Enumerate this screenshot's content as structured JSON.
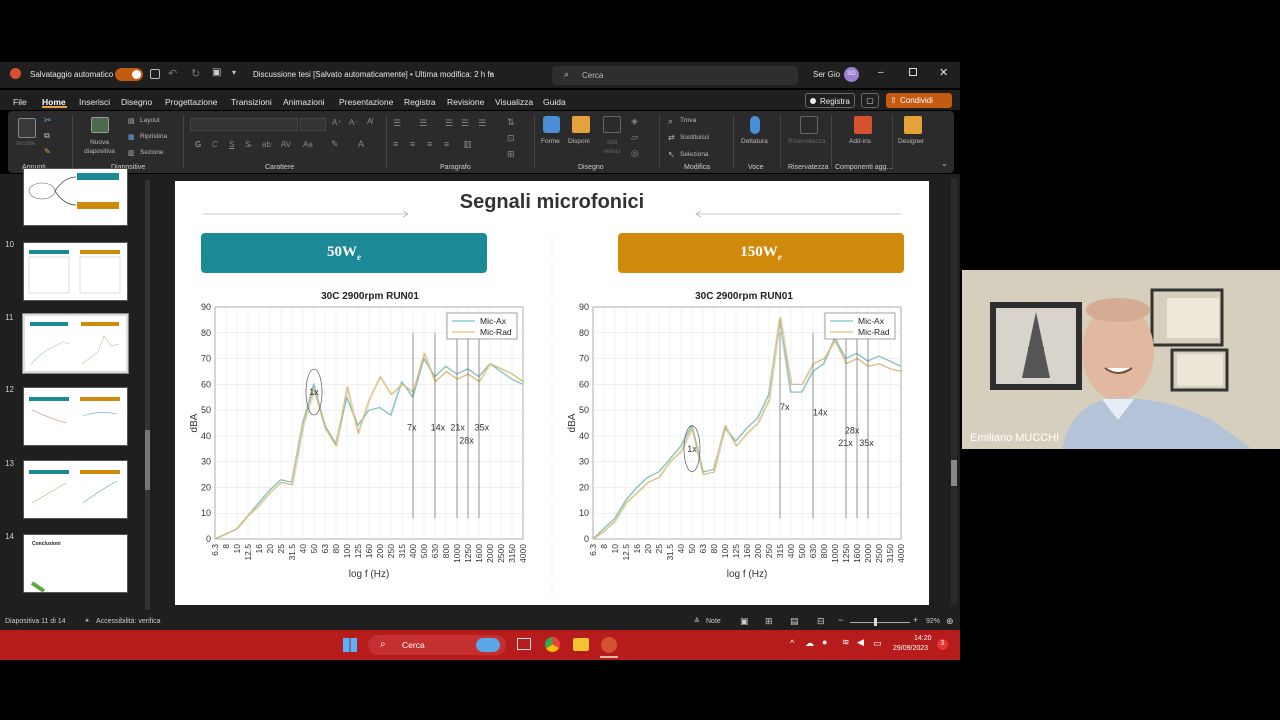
{
  "titlebar": {
    "autosave_label": "Salvataggio automatico",
    "doc_title": "Discussione tesi [Salvato automaticamente] • Ultima modifica: 2 h fa",
    "search_placeholder": "Cerca",
    "user_name": "Ser Gio",
    "user_initials": "SG"
  },
  "menu": {
    "items": [
      "File",
      "Home",
      "Inserisci",
      "Disegno",
      "Progettazione",
      "Transizioni",
      "Animazioni",
      "Presentazione",
      "Registra",
      "Revisione",
      "Visualizza",
      "Guida"
    ],
    "active": "Home",
    "record_button": "Registra",
    "share_button": "Condividi"
  },
  "ribbon": {
    "paste": "Incolla",
    "new_slide": "Nuova diapositiva",
    "layout": "Layout",
    "reset": "Ripristina",
    "section": "Sezione",
    "shapes": "Forme",
    "arrange": "Disponi",
    "quick_styles": "Stili veloci",
    "find": "Trova",
    "replace": "Sostituisci",
    "select": "Seleziona",
    "dictate": "Dettatura",
    "sensitivity": "Riservatezza",
    "addins": "Add-ins",
    "designer": "Designer",
    "groups": {
      "clipboard": "Appunti",
      "slides": "Diapositive",
      "font": "Carattere",
      "paragraph": "Paragrafo",
      "drawing": "Disegno",
      "editing": "Modifica",
      "voice": "Voce",
      "sensitivity": "Riservatezza",
      "addins": "Componenti agg..."
    }
  },
  "thumbnails": [
    {
      "num": "10"
    },
    {
      "num": "11"
    },
    {
      "num": "12"
    },
    {
      "num": "13"
    },
    {
      "num": "14",
      "title": "Conclusioni"
    }
  ],
  "slide": {
    "title": "Segnali microfonici",
    "left_header": "50W",
    "left_header_sub": "e",
    "right_header": "150W",
    "right_header_sub": "e",
    "colors": {
      "teal": "#1c8a96",
      "orange": "#d08a0b"
    }
  },
  "chart_data": [
    {
      "type": "line",
      "title": "30C 2900rpm RUN01",
      "xlabel": "log f (Hz)",
      "ylabel": "dBA",
      "ylim": [
        0,
        90
      ],
      "yticks": [
        0,
        10,
        20,
        30,
        40,
        50,
        60,
        70,
        80,
        90
      ],
      "categories": [
        "6.3",
        "8",
        "10",
        "12.5",
        "16",
        "20",
        "25",
        "31.5",
        "40",
        "50",
        "63",
        "80",
        "100",
        "125",
        "160",
        "200",
        "250",
        "315",
        "400",
        "500",
        "630",
        "800",
        "1000",
        "1250",
        "1600",
        "2000",
        "2500",
        "3150",
        "4000"
      ],
      "series": [
        {
          "name": "Mic-Ax",
          "color": "#74c6c9",
          "values": [
            0,
            2,
            4,
            9,
            14,
            19,
            23,
            22,
            45,
            60,
            44,
            37,
            55,
            44,
            50,
            51,
            48,
            61,
            55,
            70,
            63,
            67,
            64,
            66,
            63,
            68,
            65,
            62,
            60
          ]
        },
        {
          "name": "Mic-Rad",
          "color": "#e6c36a",
          "values": [
            0,
            2,
            4,
            9,
            13,
            18,
            22,
            21,
            44,
            58,
            43,
            36,
            59,
            41,
            54,
            63,
            56,
            60,
            57,
            72,
            61,
            65,
            62,
            64,
            61,
            68,
            66,
            64,
            61
          ]
        }
      ],
      "annotations": [
        "1x",
        "7x",
        "14x",
        "21x",
        "28x",
        "35x"
      ]
    },
    {
      "type": "line",
      "title": "30C 2900rpm RUN01",
      "xlabel": "log f (Hz)",
      "ylabel": "dBA",
      "ylim": [
        0,
        90
      ],
      "yticks": [
        0,
        10,
        20,
        30,
        40,
        50,
        60,
        70,
        80,
        90
      ],
      "categories": [
        "6.3",
        "8",
        "10",
        "12.5",
        "16",
        "20",
        "25",
        "31.5",
        "40",
        "50",
        "63",
        "80",
        "100",
        "125",
        "160",
        "200",
        "250",
        "315",
        "400",
        "500",
        "630",
        "800",
        "1000",
        "1250",
        "1600",
        "2000",
        "2500",
        "3150",
        "4000"
      ],
      "series": [
        {
          "name": "Mic-Ax",
          "color": "#74c6c9",
          "values": [
            0,
            4,
            8,
            15,
            20,
            24,
            26,
            31,
            36,
            44,
            26,
            27,
            43,
            38,
            43,
            47,
            56,
            85,
            57,
            57,
            65,
            68,
            78,
            70,
            72,
            69,
            71,
            69,
            67
          ]
        },
        {
          "name": "Mic-Rad",
          "color": "#e6c36a",
          "values": [
            0,
            3,
            7,
            14,
            18,
            22,
            24,
            30,
            34,
            43,
            25,
            26,
            44,
            36,
            41,
            45,
            54,
            86,
            60,
            60,
            68,
            70,
            77,
            68,
            70,
            67,
            68,
            66,
            65
          ]
        }
      ],
      "annotations": [
        "1x",
        "7x",
        "14x",
        "21x",
        "28x",
        "35x"
      ]
    }
  ],
  "status": {
    "slide_counter": "Diapositiva 11 di 14",
    "accessibility": "Accessibilità: verifica",
    "notes": "Note",
    "zoom": "92%"
  },
  "taskbar": {
    "search": "Cerca",
    "time": "14:20",
    "date": "29/09/2023",
    "badge": "3"
  },
  "webcam": {
    "name": "Emiliano MUCCHI"
  }
}
